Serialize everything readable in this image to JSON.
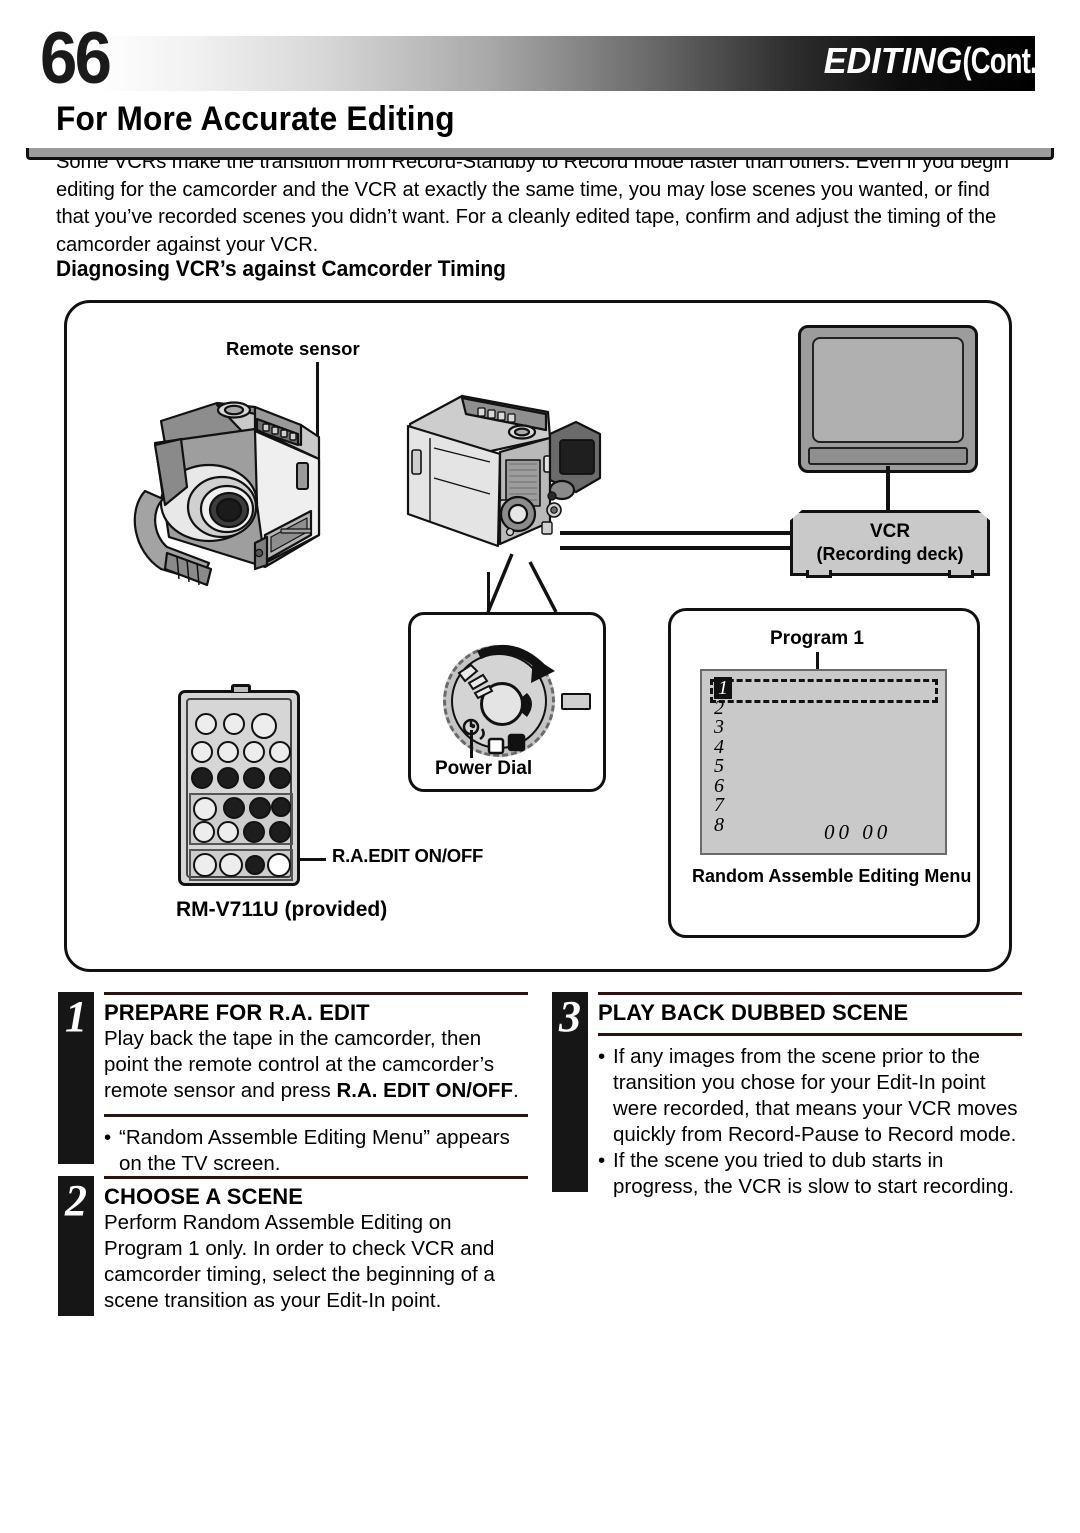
{
  "header": {
    "page_number": "66",
    "section_title": "EDITING",
    "section_cont": "(Cont.)"
  },
  "page_title": "For More Accurate Editing",
  "intro_paragraph": "Some VCRs make the transition from Record-Standby to Record mode faster than others. Even if you begin editing for the camcorder and the VCR at exactly the same time, you may lose scenes you wanted, or find that you’ve recorded scenes you didn’t want. For a cleanly edited tape, confirm and adjust the timing of the camcorder against your VCR.",
  "subheading": "Diagnosing VCR’s against Camcorder Timing",
  "diagram": {
    "remote_sensor_label": "Remote sensor",
    "vcr_label_line1": "VCR",
    "vcr_label_line2": "(Recording deck)",
    "ra_edit_label": "R.A.EDIT ON/OFF",
    "remote_model_label": "RM-V711U (provided)",
    "power_dial_label": "Power Dial",
    "program_label": "Program 1",
    "menu_caption": "Random Assemble Editing Menu",
    "menu_rows": [
      "1",
      "2",
      "3",
      "4",
      "5",
      "6",
      "7",
      "8"
    ],
    "menu_selected_row": "1",
    "menu_timecode": "00  00"
  },
  "steps": [
    {
      "number": "1",
      "title": "PREPARE FOR R.A. EDIT",
      "text_parts": [
        "Play back the tape in the camcorder, then point the remote control at the camcorder’s remote sensor and press ",
        "R.A. EDIT ON/OFF",
        "."
      ],
      "bullets": [
        "“Random Assemble Editing Menu” appears on the TV screen."
      ]
    },
    {
      "number": "2",
      "title": "CHOOSE A SCENE",
      "text": "Perform Random Assemble Editing on Program 1 only. In order to check VCR and camcorder timing, select the beginning of a scene transition as your Edit-In point.",
      "bullets": []
    },
    {
      "number": "3",
      "title": "PLAY BACK DUBBED SCENE",
      "text": "",
      "bullets": [
        "If any images from the scene prior to the transition you chose for your Edit-In point were recorded, that means your VCR moves quickly from Record-Pause to Record mode.",
        "If the scene you tried to dub starts in progress, the VCR is slow to start recording."
      ]
    }
  ],
  "colors": {
    "ink": "#000000",
    "rule": "#2b1510",
    "panel_border": "#111111",
    "device_gray": "#c9c9c9",
    "screen_gray": "#b0b0b0"
  }
}
